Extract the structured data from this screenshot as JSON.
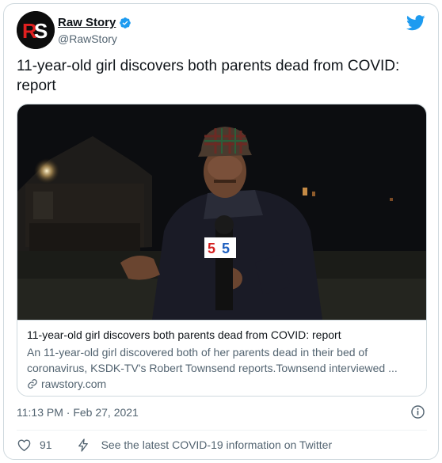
{
  "author": {
    "display_name": "Raw Story",
    "handle": "@RawStory",
    "avatar_icon": "raw-story-logo",
    "verified": true
  },
  "tweet": {
    "text": "11-year-old girl discovers both parents dead from COVID: report",
    "timestamp": "11:13 PM · Feb 27, 2021"
  },
  "link_card": {
    "title": "11-year-old girl discovers both parents dead from COVID: report",
    "description": "An 11-year-old girl discovered both of her parents dead in their bed of coronavirus, KSDK-TV's Robert Townsend reports.Townsend interviewed ...",
    "domain": "rawstory.com",
    "image_alt": "Reporter in plaid cap holding KSDK 5 microphone at night"
  },
  "actions": {
    "likes": "91",
    "covid_info": "See the latest COVID-19 information on Twitter"
  },
  "colors": {
    "twitter_blue": "#1d9bf0",
    "text_primary": "#0f1419",
    "text_secondary": "#536471",
    "border": "#cfd9de",
    "rawstory_red": "#e02020"
  }
}
